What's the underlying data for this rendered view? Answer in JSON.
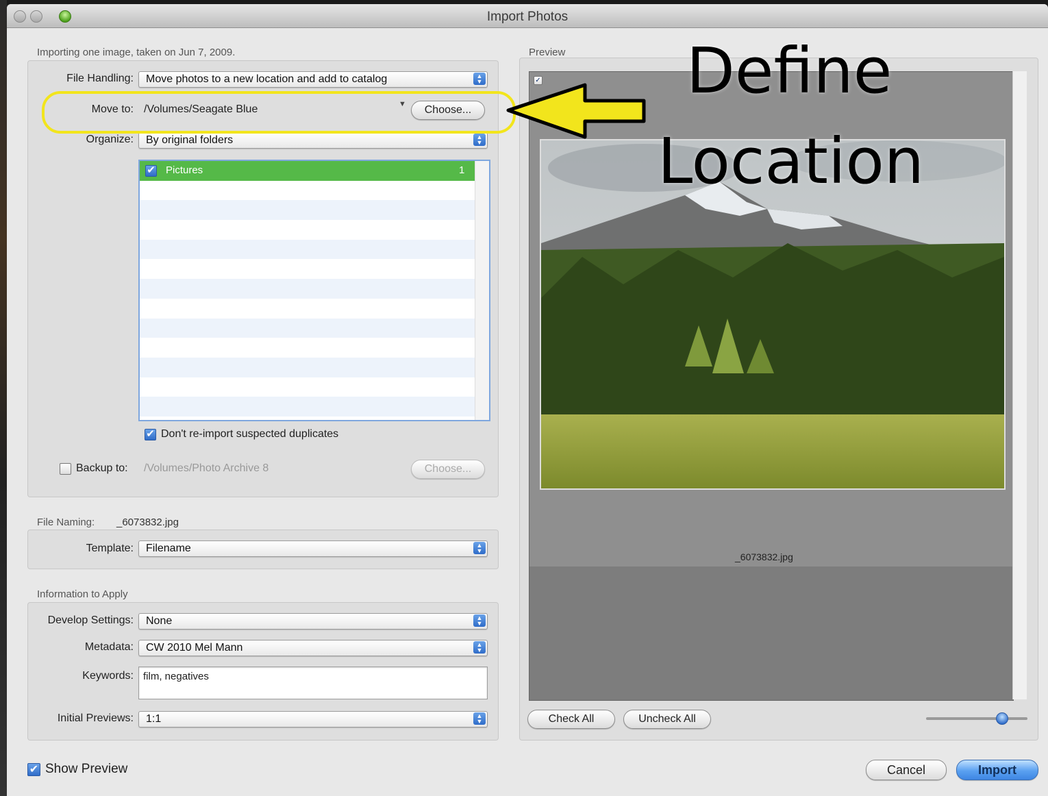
{
  "window": {
    "title": "Import Photos"
  },
  "import_options": {
    "summary": "Importing one image, taken on Jun 7, 2009.",
    "file_handling": {
      "label": "File Handling:",
      "value": "Move photos to a new location and add to catalog"
    },
    "move_to": {
      "label": "Move to:",
      "path": "/Volumes/Seagate Blue",
      "button": "Choose..."
    },
    "organize": {
      "label": "Organize:",
      "value": "By original folders"
    },
    "folders": [
      {
        "name": "Pictures",
        "count": "1",
        "checked": true
      }
    ],
    "dont_reimport": {
      "label": "Don't re-import suspected duplicates",
      "checked": true
    },
    "backup": {
      "label": "Backup to:",
      "path": "/Volumes/Photo Archive 8",
      "button": "Choose...",
      "checked": false
    }
  },
  "file_naming": {
    "label": "File Naming:",
    "example": "_6073832.jpg",
    "template": {
      "label": "Template:",
      "value": "Filename"
    }
  },
  "info_to_apply": {
    "title": "Information to Apply",
    "develop_settings": {
      "label": "Develop Settings:",
      "value": "None"
    },
    "metadata": {
      "label": "Metadata:",
      "value": "CW 2010 Mel Mann"
    },
    "keywords": {
      "label": "Keywords:",
      "value": "film, negatives"
    },
    "initial_previews": {
      "label": "Initial Previews:",
      "value": "1:1"
    }
  },
  "preview": {
    "title": "Preview",
    "filename": "_6073832.jpg",
    "check_all": "Check All",
    "uncheck_all": "Uncheck All",
    "thumb_size": 0.8
  },
  "footer": {
    "show_preview": {
      "label": "Show Preview",
      "checked": true
    },
    "cancel": "Cancel",
    "import": "Import"
  },
  "annotation": {
    "line1": "Define",
    "line2": "Location",
    "color": "#f2e51c"
  },
  "icons": {
    "popup_arrows": "updown-arrows-icon",
    "check": "checkmark-icon",
    "dropdown": "triangle-down-icon"
  }
}
